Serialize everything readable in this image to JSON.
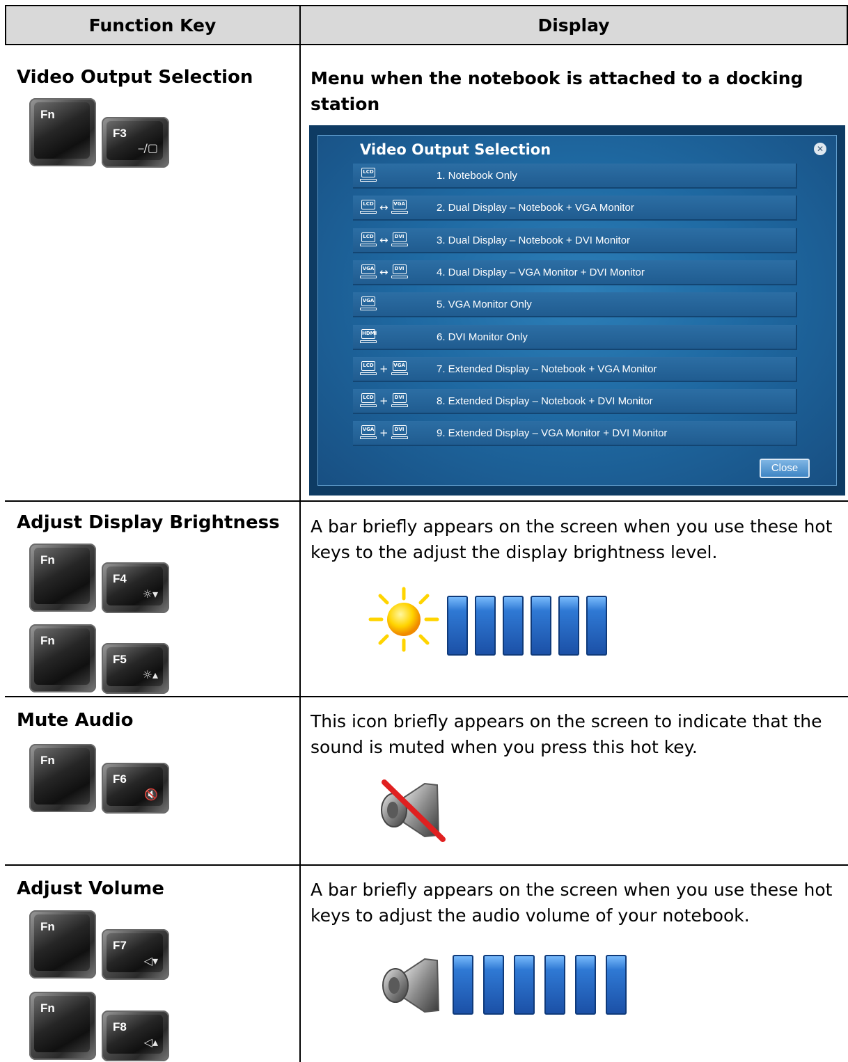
{
  "table": {
    "headers": [
      "Function Key",
      "Display"
    ]
  },
  "rows": [
    {
      "title": "Video Output Selection",
      "keys": [
        {
          "label": "Fn",
          "symbol": ""
        },
        {
          "label": "F3",
          "symbol": "⎯/▢"
        }
      ],
      "description": "Menu when the notebook is attached to a docking station"
    },
    {
      "title": "Adjust Display Brightness",
      "keys": [
        {
          "label": "Fn",
          "symbol": ""
        },
        {
          "label": "F4",
          "symbol": "☼▾"
        },
        {
          "label": "Fn",
          "symbol": ""
        },
        {
          "label": "F5",
          "symbol": "☼▴"
        }
      ],
      "description": "A bar briefly appears on the screen when you use these hot keys to the adjust the display brightness level.",
      "level_bars": 6
    },
    {
      "title": "Mute Audio",
      "keys": [
        {
          "label": "Fn",
          "symbol": ""
        },
        {
          "label": "F6",
          "symbol": "🔇"
        }
      ],
      "description": "This icon briefly appears on the screen to indicate that the sound is muted when you press this hot key."
    },
    {
      "title": "Adjust Volume",
      "keys": [
        {
          "label": "Fn",
          "symbol": ""
        },
        {
          "label": "F7",
          "symbol": "◁▾"
        },
        {
          "label": "Fn",
          "symbol": ""
        },
        {
          "label": "F8",
          "symbol": "◁▴"
        }
      ],
      "description": "A bar briefly appears on the screen when you use these hot keys to adjust the audio volume of your notebook.",
      "level_bars": 6
    }
  ],
  "dialog": {
    "title": "Video Output Selection",
    "close_label": "Close",
    "options": [
      {
        "icons": [
          "LCD"
        ],
        "op": "",
        "label": "1. Notebook Only"
      },
      {
        "icons": [
          "LCD",
          "VGA"
        ],
        "op": "↔",
        "label": "2. Dual Display – Notebook + VGA Monitor"
      },
      {
        "icons": [
          "LCD",
          "DVI"
        ],
        "op": "↔",
        "label": "3. Dual Display – Notebook + DVI Monitor"
      },
      {
        "icons": [
          "VGA",
          "DVI"
        ],
        "op": "↔",
        "label": "4. Dual Display – VGA Monitor + DVI Monitor"
      },
      {
        "icons": [
          "VGA"
        ],
        "op": "",
        "label": "5. VGA Monitor Only"
      },
      {
        "icons": [
          "HDMI"
        ],
        "op": "",
        "label": "6. DVI Monitor Only"
      },
      {
        "icons": [
          "LCD",
          "VGA"
        ],
        "op": "+",
        "label": "7. Extended Display – Notebook + VGA Monitor"
      },
      {
        "icons": [
          "LCD",
          "DVI"
        ],
        "op": "+",
        "label": "8. Extended Display – Notebook + DVI Monitor"
      },
      {
        "icons": [
          "VGA",
          "DVI"
        ],
        "op": "+",
        "label": "9. Extended Display – VGA Monitor + DVI Monitor"
      }
    ]
  },
  "icons": {
    "sun": "sun-icon",
    "speaker_muted": "speaker-muted-icon",
    "speaker": "speaker-icon"
  },
  "colors": {
    "header_bg": "#d9d9d9",
    "dialog_bg": "#1f6aa3",
    "bar_blue": "#2f79d4",
    "sun_yellow": "#ffd400",
    "mute_red": "#e02020"
  }
}
